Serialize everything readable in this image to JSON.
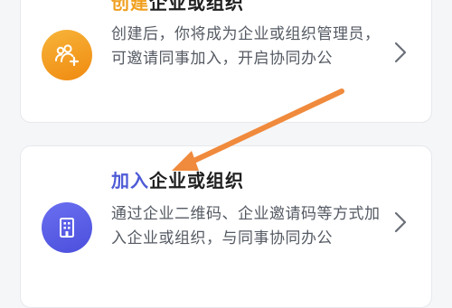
{
  "cards": [
    {
      "title_accent": "创建",
      "title_rest": "企业或组织",
      "description": "创建后，你将成为企业或组织管理员，可邀请同事加入，开启协同办公",
      "icon": "team-add-icon",
      "accent_color": "#f0a020"
    },
    {
      "title_accent": "加入",
      "title_rest": "企业或组织",
      "description": "通过企业二维码、企业邀请码等方式加入企业或组织，与同事协同办公",
      "icon": "building-icon",
      "accent_color": "#4e5bd6"
    }
  ],
  "annotation": {
    "arrow_color": "#f08a3c"
  }
}
